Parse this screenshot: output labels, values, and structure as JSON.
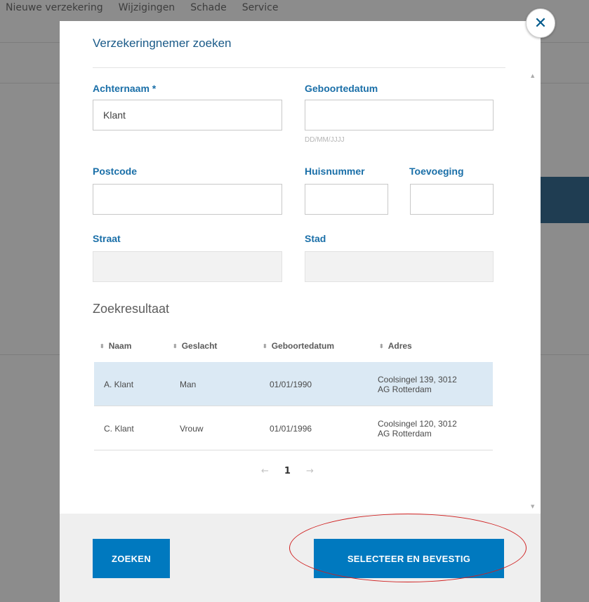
{
  "background": {
    "nav": [
      "Nieuwe verzekering",
      "Wijzigingen",
      "Schade",
      "Service"
    ]
  },
  "modal": {
    "title": "Verzekeringnemer zoeken",
    "close_icon": "close-icon"
  },
  "form": {
    "achternaam": {
      "label": "Achternaam *",
      "value": "Klant"
    },
    "geboortedatum": {
      "label": "Geboortedatum",
      "value": "",
      "hint": "DD/MM/JJJJ"
    },
    "postcode": {
      "label": "Postcode",
      "value": ""
    },
    "huisnummer": {
      "label": "Huisnummer",
      "value": ""
    },
    "toevoeging": {
      "label": "Toevoeging",
      "value": ""
    },
    "straat": {
      "label": "Straat",
      "value": ""
    },
    "stad": {
      "label": "Stad",
      "value": ""
    }
  },
  "results": {
    "title": "Zoekresultaat",
    "columns": [
      "Naam",
      "Geslacht",
      "Geboortedatum",
      "Adres"
    ],
    "rows": [
      {
        "naam": "A. Klant",
        "geslacht": "Man",
        "geboortedatum": "01/01/1990",
        "adres_line1": "Coolsingel 139, 3012",
        "adres_line2": "AG Rotterdam",
        "selected": true
      },
      {
        "naam": "C. Klant",
        "geslacht": "Vrouw",
        "geboortedatum": "01/01/1996",
        "adres_line1": "Coolsingel 120, 3012",
        "adres_line2": "AG Rotterdam",
        "selected": false
      }
    ],
    "pagination": {
      "prev": "←",
      "page": "1",
      "next": "→"
    }
  },
  "buttons": {
    "search": "ZOEKEN",
    "confirm": "SELECTEER EN BEVESTIG"
  },
  "colors": {
    "accent": "#0079bf",
    "label": "#1a6fa8",
    "selected_row": "#dbe9f4",
    "highlight": "#d02020"
  }
}
